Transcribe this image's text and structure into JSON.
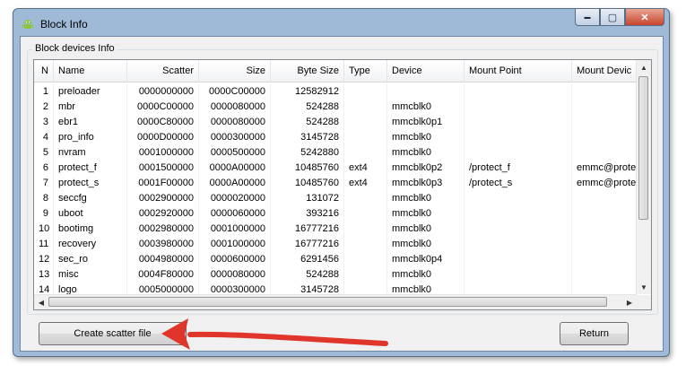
{
  "window": {
    "title": "Block Info"
  },
  "window_buttons": {
    "minimize": "▬",
    "maximize": "▢",
    "close": "✕"
  },
  "group": {
    "label": "Block devices Info"
  },
  "table": {
    "columns": [
      "N",
      "Name",
      "Scatter",
      "Size",
      "Byte Size",
      "Type",
      "Device",
      "Mount Point",
      "Mount Devic"
    ],
    "rows": [
      [
        "1",
        "preloader",
        "0000000000",
        "0000C00000",
        "12582912",
        "",
        "",
        "",
        ""
      ],
      [
        "2",
        "mbr",
        "0000C00000",
        "0000080000",
        "524288",
        "",
        "mmcblk0",
        "",
        ""
      ],
      [
        "3",
        "ebr1",
        "0000C80000",
        "0000080000",
        "524288",
        "",
        "mmcblk0p1",
        "",
        ""
      ],
      [
        "4",
        "pro_info",
        "0000D00000",
        "0000300000",
        "3145728",
        "",
        "mmcblk0",
        "",
        ""
      ],
      [
        "5",
        "nvram",
        "0001000000",
        "0000500000",
        "5242880",
        "",
        "mmcblk0",
        "",
        ""
      ],
      [
        "6",
        "protect_f",
        "0001500000",
        "0000A00000",
        "10485760",
        "ext4",
        "mmcblk0p2",
        "/protect_f",
        "emmc@prote"
      ],
      [
        "7",
        "protect_s",
        "0001F00000",
        "0000A00000",
        "10485760",
        "ext4",
        "mmcblk0p3",
        "/protect_s",
        "emmc@prote"
      ],
      [
        "8",
        "seccfg",
        "0002900000",
        "0000020000",
        "131072",
        "",
        "mmcblk0",
        "",
        ""
      ],
      [
        "9",
        "uboot",
        "0002920000",
        "0000060000",
        "393216",
        "",
        "mmcblk0",
        "",
        ""
      ],
      [
        "10",
        "bootimg",
        "0002980000",
        "0001000000",
        "16777216",
        "",
        "mmcblk0",
        "",
        ""
      ],
      [
        "11",
        "recovery",
        "0003980000",
        "0001000000",
        "16777216",
        "",
        "mmcblk0",
        "",
        ""
      ],
      [
        "12",
        "sec_ro",
        "0004980000",
        "0000600000",
        "6291456",
        "",
        "mmcblk0p4",
        "",
        ""
      ],
      [
        "13",
        "misc",
        "0004F80000",
        "0000080000",
        "524288",
        "",
        "mmcblk0",
        "",
        ""
      ],
      [
        "14",
        "logo",
        "0005000000",
        "0000300000",
        "3145728",
        "",
        "mmcblk0",
        "",
        ""
      ]
    ]
  },
  "buttons": {
    "create_scatter": "Create scatter file",
    "return": "Return"
  },
  "icons": {
    "app": "android-icon",
    "scroll_up": "scroll-up-arrow-icon",
    "scroll_down": "scroll-down-arrow-icon",
    "scroll_left": "scroll-left-arrow-icon",
    "scroll_right": "scroll-right-arrow-icon"
  },
  "colors": {
    "annotation_arrow": "#e0352b",
    "title_bar": "#9fbad6",
    "close_button": "#c7442e"
  }
}
